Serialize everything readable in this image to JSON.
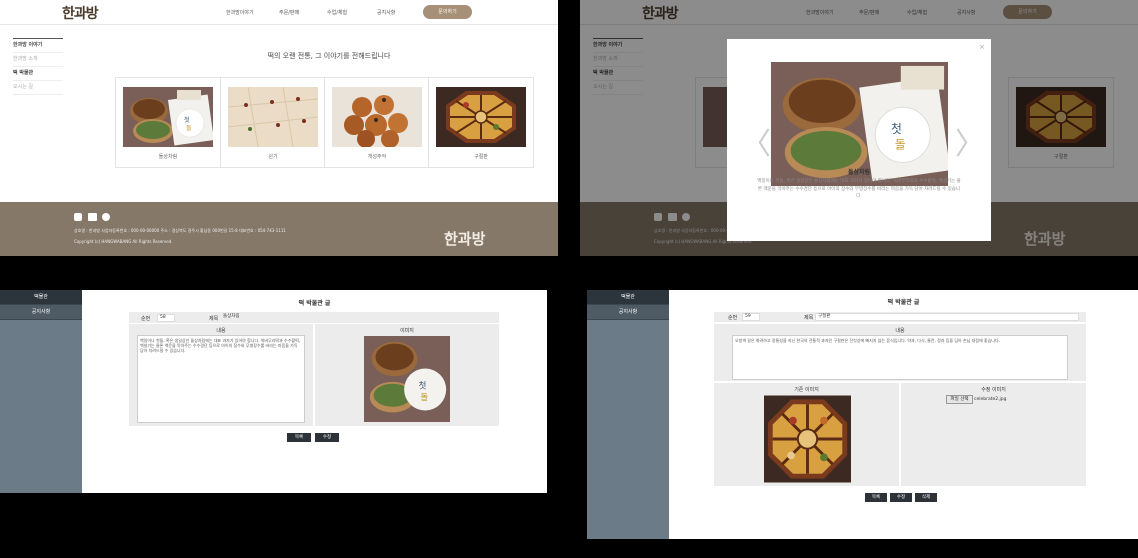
{
  "site": {
    "logo": "한과방",
    "nav": [
      "한과방이야기",
      "주문/판매",
      "수업/체험",
      "공지사항"
    ],
    "inquiry_button": "문의하기",
    "left_nav": [
      "한과방 이야기",
      "한과방 소개",
      "떡 박물관",
      "오시는 길"
    ],
    "headline": "떡의 오랜 전통, 그 이야기를 전해드립니다",
    "cards": [
      "돌상차림",
      "쉰기",
      "개성주악",
      "구절판"
    ],
    "footer": {
      "line1": "상호명 : 한과방    사업자등록번호 : 000-00-00000    주소 : 경상북도 경주시 황남동 000번길 15-8    대표번호 : 054-743-1111",
      "copyright": "Copyright (c) HANGWABANG All Rights Reserved.",
      "logo": "한과방"
    }
  },
  "modal": {
    "close": "×",
    "prev": "〈",
    "next": "〉",
    "title": "돌상차림",
    "desc": "백일이나 첫돌, 혹은 생일상인 돌상차림에는 대표 과자가 있어야 합니다. 쑥버무리떡과 수수팥떡, 백설기는 물론 액운을 막아주는 수수경단 등으로 아이의 장수와 무병장수를 바라는 마음을 가득 담아 차려드릴 수 있습니다."
  },
  "admin_left": {
    "sidebar": [
      "떡물관",
      "공지사항"
    ],
    "title": "떡 박물관 글",
    "no_label": "순번",
    "no_value": "58",
    "subject_label": "제목",
    "subject_value": "돌상차림",
    "content_label": "내용",
    "image_label": "이미지",
    "content_text": "백일이나 첫돌, 혹은 생일상인 돌상차림에는 대표 과자가 있어야 합니다. 쑥버무리떡과 수수팥떡, 백설기는 물론 액운을 막아주는 수수경단 등으로 아이의 장수와 무병장수를 바라는 마음을 가득 담아 차려드릴 수 있습니다.",
    "buttons": [
      "목록",
      "수정"
    ]
  },
  "admin_right": {
    "sidebar": [
      "떡물관",
      "공지사항"
    ],
    "title": "떡 박물관 글",
    "no_label": "순번",
    "no_value": "59",
    "subject_label": "제목",
    "subject_value": "구절판",
    "content_label": "내용",
    "content_text": "오방색 갈은 화려하고 정통성을 지닌 한국의 전통적 과자인 구절판은 잔칫상에 빠지지 않는 음식입니다. 약과, 다식, 율란, 정과 등을 담아 손님 대접에 좋습니다.",
    "orig_image_label": "기존 이미지",
    "new_image_label": "수정 이미지",
    "file_button": "파일 선택",
    "file_name": "celebrate2.jpg",
    "buttons": [
      "목록",
      "수정",
      "삭제"
    ]
  }
}
